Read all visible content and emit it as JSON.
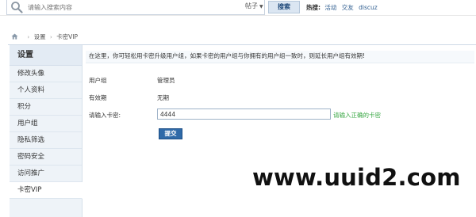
{
  "search": {
    "placeholder": "请输入搜索内容",
    "scope": "帖子",
    "button": "搜索"
  },
  "hot": {
    "label": "热搜:",
    "items": [
      "活动",
      "交友",
      "discuz"
    ]
  },
  "breadcrumb": {
    "items": [
      "设置",
      "卡密VIP"
    ]
  },
  "sidebar": {
    "title": "设置",
    "items": [
      {
        "label": "修改头像"
      },
      {
        "label": "个人资料"
      },
      {
        "label": "积分"
      },
      {
        "label": "用户组"
      },
      {
        "label": "隐私筛选"
      },
      {
        "label": "密码安全"
      },
      {
        "label": "访问推广"
      },
      {
        "label": "卡密VIP"
      }
    ],
    "active_index": 7
  },
  "main": {
    "notice": "在这里，你可轻松用卡密升级用户组，如果卡密的用户组与你拥有的用户组一致时，则延长用户组有效期!",
    "usergroup_label": "用户组",
    "usergroup_value": "管理员",
    "expiry_label": "有效期",
    "expiry_value": "无期",
    "code_label": "请输入卡密:",
    "code_value": "4444",
    "hint": "请输入正确的卡密",
    "submit": "提交"
  },
  "watermark": "www.uuid2.com"
}
